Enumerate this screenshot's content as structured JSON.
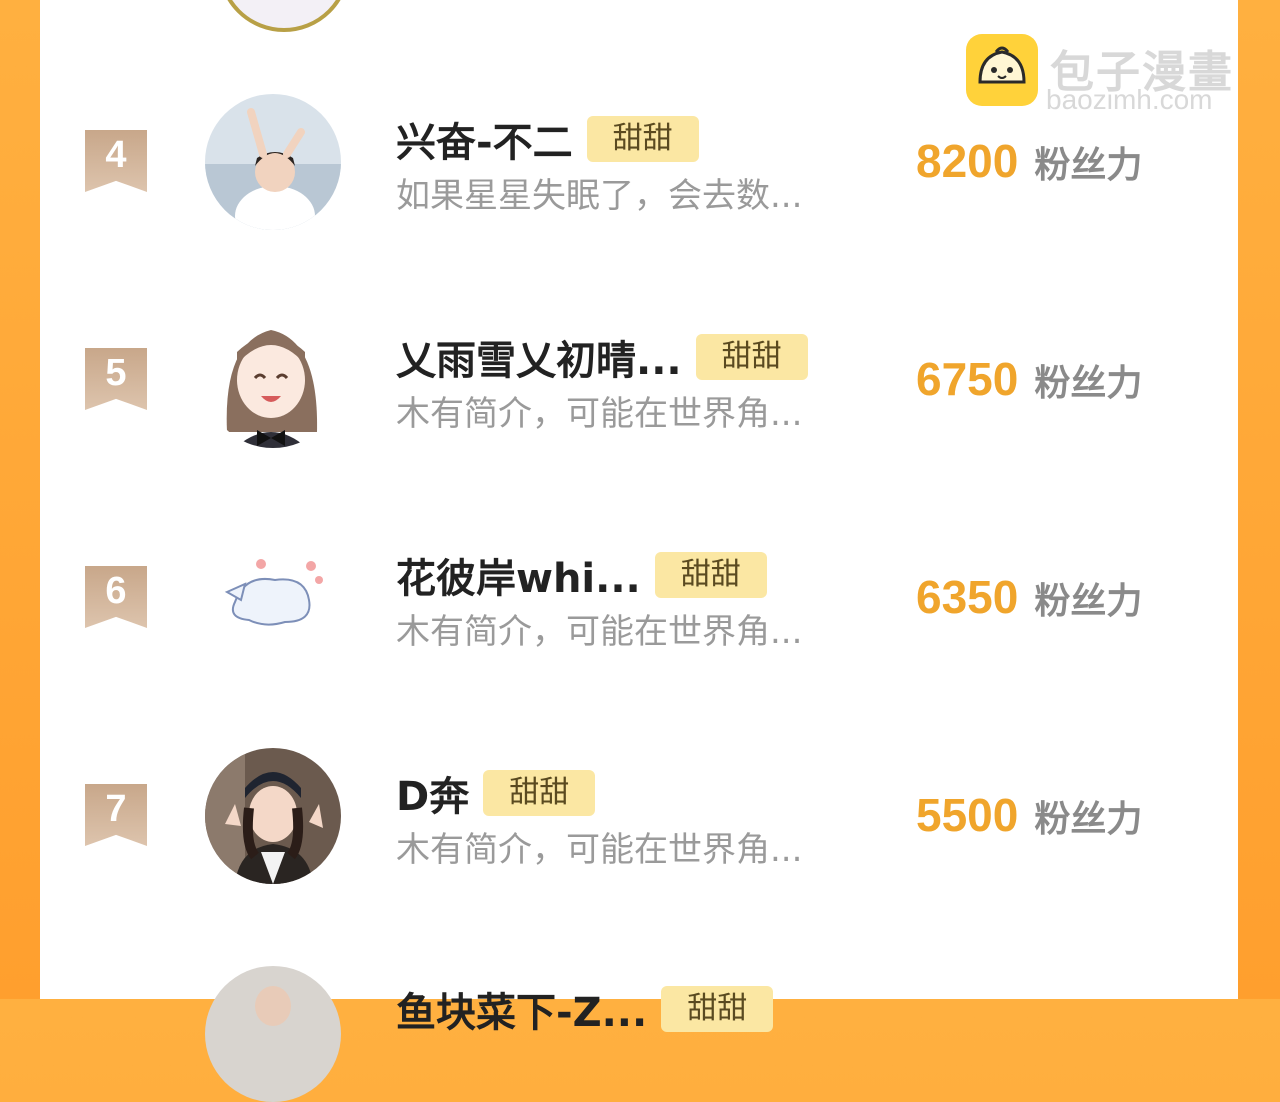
{
  "watermark": {
    "brand": "包子漫畫",
    "url": "baozimh.com",
    "icon": "bun-logo-icon"
  },
  "colors": {
    "score": "#f0a52c",
    "tag_bg": "#fbe7a3",
    "rank_badge": "#c8a78a",
    "frame": "#ff9f2e"
  },
  "rows": [
    {
      "rank": "4",
      "name": "兴奋-不二",
      "tag": "甜甜",
      "bio": "如果星星失眠了，会去数...",
      "score": "8200",
      "unit": "粉丝力"
    },
    {
      "rank": "5",
      "name": "乂雨雪乂初晴...",
      "tag": "甜甜",
      "bio": "木有简介，可能在世界角...",
      "score": "6750",
      "unit": "粉丝力"
    },
    {
      "rank": "6",
      "name": "花彼岸whi...",
      "tag": "甜甜",
      "bio": "木有简介，可能在世界角...",
      "score": "6350",
      "unit": "粉丝力"
    },
    {
      "rank": "7",
      "name": "D奔",
      "tag": "甜甜",
      "bio": "木有简介，可能在世界角...",
      "score": "5500",
      "unit": "粉丝力"
    },
    {
      "name": "鱼块菜下-Z...",
      "tag": "甜甜"
    }
  ]
}
